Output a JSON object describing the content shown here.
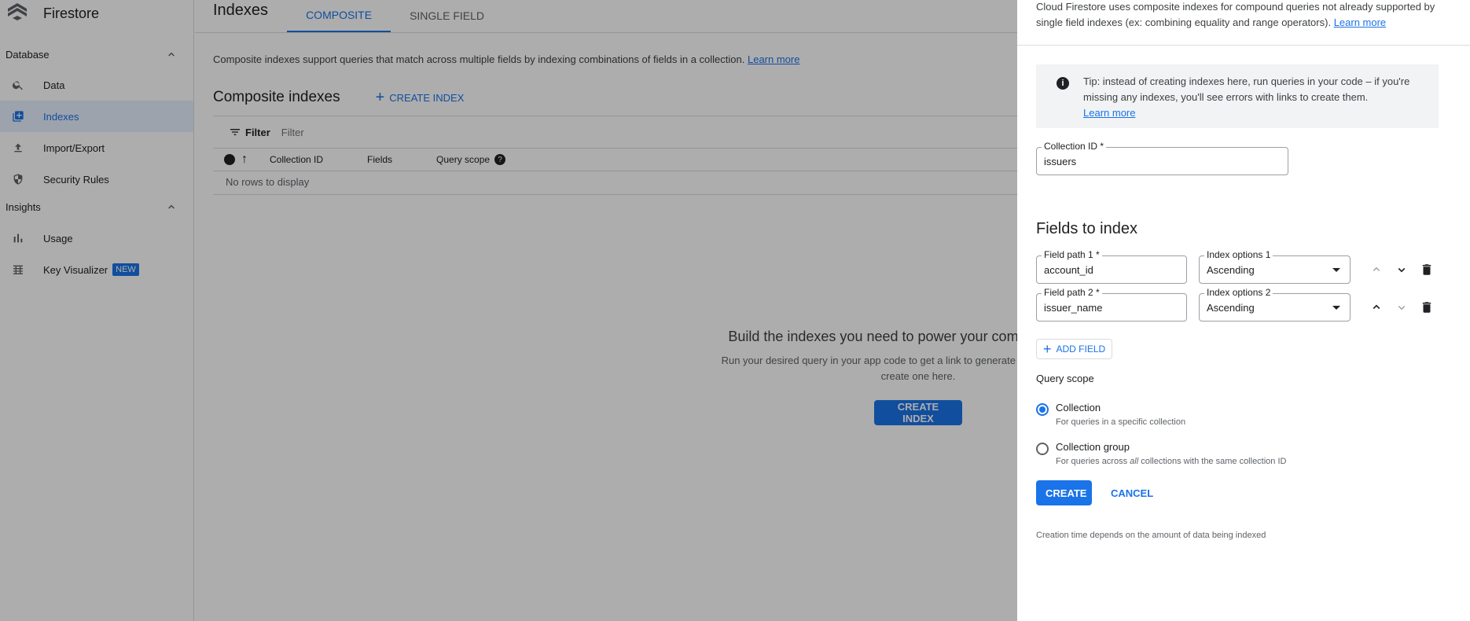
{
  "app": {
    "title": "Firestore"
  },
  "sidebar": {
    "sections": [
      {
        "title": "Database",
        "items": [
          {
            "label": "Data",
            "icon": "search-icon"
          },
          {
            "label": "Indexes",
            "icon": "indexes-icon",
            "active": true
          },
          {
            "label": "Import/Export",
            "icon": "upload-icon"
          },
          {
            "label": "Security Rules",
            "icon": "shield-icon"
          }
        ]
      },
      {
        "title": "Insights",
        "items": [
          {
            "label": "Usage",
            "icon": "bar-chart-icon"
          },
          {
            "label": "Key Visualizer",
            "icon": "grid-icon",
            "badge": "NEW"
          }
        ]
      }
    ]
  },
  "main": {
    "title": "Indexes",
    "tabs": [
      {
        "label": "COMPOSITE",
        "active": true
      },
      {
        "label": "SINGLE FIELD"
      }
    ],
    "intro": "Composite indexes support queries that match across multiple fields by indexing combinations of fields in a collection.",
    "learn_more": "Learn more",
    "section_title": "Composite indexes",
    "create_index_link": "CREATE INDEX",
    "filter": {
      "label": "Filter",
      "placeholder": "Filter"
    },
    "table": {
      "columns": [
        "Collection ID",
        "Fields",
        "Query scope"
      ],
      "empty": "No rows to display"
    },
    "empty_state": {
      "title": "Build the indexes you need to power your compound queries",
      "line1": "Run your desired query in your app code to get a link to generate the required index, or",
      "line2": "create one here.",
      "button": "CREATE INDEX"
    }
  },
  "panel": {
    "desc": "Cloud Firestore uses composite indexes for compound queries not already supported by single field indexes (ex: combining equality and range operators).",
    "desc_link": "Learn more",
    "tip": "Tip: instead of creating indexes here, run queries in your code – if you're missing any indexes, you'll see errors with links to create them.",
    "tip_link": "Learn more",
    "collection": {
      "label": "Collection ID *",
      "value": "issuers"
    },
    "fields_title": "Fields to index",
    "fields": [
      {
        "path_label": "Field path 1 *",
        "path": "account_id",
        "opt_label": "Index options 1",
        "opt": "Ascending"
      },
      {
        "path_label": "Field path 2 *",
        "path": "issuer_name",
        "opt_label": "Index options 2",
        "opt": "Ascending"
      }
    ],
    "add_field": "ADD FIELD",
    "query_scope": {
      "label": "Query scope",
      "options": [
        {
          "title": "Collection",
          "sub": "For queries in a specific collection",
          "selected": true
        },
        {
          "title": "Collection group",
          "sub_pre": "For queries across ",
          "sub_em": "all",
          "sub_post": " collections with the same collection ID",
          "selected": false
        }
      ]
    },
    "create": "CREATE",
    "cancel": "CANCEL",
    "footnote": "Creation time depends on the amount of data being indexed"
  },
  "colors": {
    "accent": "#1a73e8",
    "scrim": "rgba(0,0,0,0.32)"
  }
}
